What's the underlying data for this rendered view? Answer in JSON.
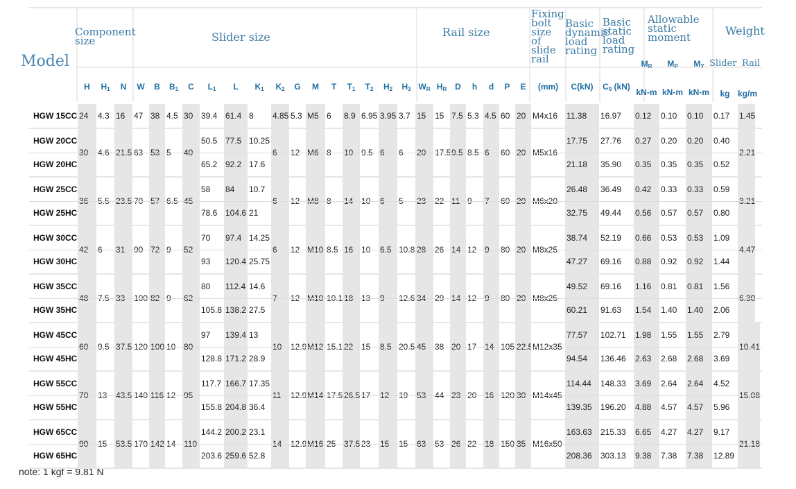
{
  "header": {
    "model": "Model",
    "groups": [
      {
        "id": "component",
        "label": "Component\nsize"
      },
      {
        "id": "slider",
        "label": "Slider size"
      },
      {
        "id": "rail",
        "label": "Rail size"
      },
      {
        "id": "bolt",
        "label": "Fixing\nbolt\nsize\nof\nslide\nrail"
      },
      {
        "id": "dyn",
        "label": "Basic\ndynamic\nload\nrating"
      },
      {
        "id": "stat",
        "label": "Basic\nstatic\nload\nrating"
      },
      {
        "id": "moment",
        "label": "Allowable\nstatic\nmoment"
      },
      {
        "id": "weight",
        "label": "Weight"
      }
    ],
    "columns": [
      {
        "main": "H",
        "sub": ""
      },
      {
        "main": "H",
        "sub": "1"
      },
      {
        "main": "N",
        "sub": ""
      },
      {
        "main": "W",
        "sub": ""
      },
      {
        "main": "B",
        "sub": ""
      },
      {
        "main": "B",
        "sub": "1"
      },
      {
        "main": "C",
        "sub": ""
      },
      {
        "main": "L",
        "sub": "1"
      },
      {
        "main": "L",
        "sub": ""
      },
      {
        "main": "K",
        "sub": "1"
      },
      {
        "main": "K",
        "sub": "2"
      },
      {
        "main": "G",
        "sub": ""
      },
      {
        "main": "M",
        "sub": ""
      },
      {
        "main": "T",
        "sub": ""
      },
      {
        "main": "T",
        "sub": "1"
      },
      {
        "main": "T",
        "sub": "2"
      },
      {
        "main": "H",
        "sub": "2"
      },
      {
        "main": "H",
        "sub": "3"
      },
      {
        "main": "W",
        "sub": "R"
      },
      {
        "main": "H",
        "sub": "R"
      },
      {
        "main": "D",
        "sub": ""
      },
      {
        "main": "h",
        "sub": ""
      },
      {
        "main": "d",
        "sub": ""
      },
      {
        "main": "P",
        "sub": ""
      },
      {
        "main": "E",
        "sub": ""
      },
      {
        "main": "(mm)",
        "sub": ""
      },
      {
        "main": "C(kN)",
        "sub": ""
      },
      {
        "main": "C",
        "sub": "0",
        "tail": " (kN)"
      }
    ],
    "moments": [
      {
        "main": "M",
        "sub": "R",
        "unit": "kN-m"
      },
      {
        "main": "M",
        "sub": "P",
        "unit": "kN-m"
      },
      {
        "main": "M",
        "sub": "Y",
        "unit": "kN-m"
      }
    ],
    "weight_cols": [
      {
        "label": "Slider",
        "unit": "kg"
      },
      {
        "label": "Rail",
        "unit": "kg/m"
      }
    ]
  },
  "rows": [
    {
      "model": "HGW 15CC",
      "cells": [
        "24",
        "4.3",
        "16",
        "47",
        "38",
        "4.5",
        "30",
        "39.4",
        "61.4",
        "8",
        "4.85",
        "5.3",
        "M5",
        "6",
        "8.9",
        "6.95",
        "3.95",
        "3.7",
        "15",
        "15",
        "7.5",
        "5.3",
        "4.5",
        "60",
        "20",
        "M4x16",
        "11.38",
        "16.97",
        "0.12",
        "0.10",
        "0.10",
        "0.17",
        "1.45"
      ]
    },
    {
      "group": [
        {
          "model": "HGW 20CC",
          "L1": "50.5",
          "L": "77.5",
          "K1": "10.25",
          "C": "17.75",
          "C0": "27.76",
          "MR": "0.27",
          "MP": "0.20",
          "MY": "0.20",
          "kg": "0.40"
        },
        {
          "model": "HGW 20HC",
          "L1": "65.2",
          "L": "92.2",
          "K1": "17.6",
          "C": "21.18",
          "C0": "35.90",
          "MR": "0.35",
          "MP": "0.35",
          "MY": "0.35",
          "kg": "0.52"
        }
      ],
      "shared": {
        "H": "30",
        "H1": "4.6",
        "N": "21.5",
        "W": "63",
        "B": "53",
        "B1": "5",
        "Cc": "40",
        "K2": "6",
        "G": "12",
        "M": "M6",
        "T": "8",
        "T1": "10",
        "T2": "9.5",
        "H2": "6",
        "H3": "6",
        "WR": "20",
        "HR": "17.5",
        "D": "9.5",
        "h": "8.5",
        "d": "6",
        "P": "60",
        "E": "20",
        "bolt": "M5x16",
        "rail": "2.21"
      }
    },
    {
      "group": [
        {
          "model": "HGW 25CC",
          "L1": "58",
          "L": "84",
          "K1": "10.7",
          "C": "26.48",
          "C0": "36.49",
          "MR": "0.42",
          "MP": "0.33",
          "MY": "0.33",
          "kg": "0.59"
        },
        {
          "model": "HGW 25HC",
          "L1": "78.6",
          "L": "104.6",
          "K1": "21",
          "C": "32.75",
          "C0": "49.44",
          "MR": "0.56",
          "MP": "0.57",
          "MY": "0.57",
          "kg": "0.80"
        }
      ],
      "shared": {
        "H": "36",
        "H1": "5.5",
        "N": "23.5",
        "W": "70",
        "B": "57",
        "B1": "6.5",
        "Cc": "45",
        "K2": "6",
        "G": "12",
        "M": "M8",
        "T": "8",
        "T1": "14",
        "T2": "10",
        "H2": "6",
        "H3": "5",
        "WR": "23",
        "HR": "22",
        "D": "11",
        "h": "9",
        "d": "7",
        "P": "60",
        "E": "20",
        "bolt": "M6x20",
        "rail": "3.21"
      }
    },
    {
      "group": [
        {
          "model": "HGW 30CC",
          "L1": "70",
          "L": "97.4",
          "K1": "14.25",
          "C": "38.74",
          "C0": "52.19",
          "MR": "0.66",
          "MP": "0.53",
          "MY": "0.53",
          "kg": "1.09"
        },
        {
          "model": "HGW 30HC",
          "L1": "93",
          "L": "120.4",
          "K1": "25.75",
          "C": "47.27",
          "C0": "69.16",
          "MR": "0.88",
          "MP": "0.92",
          "MY": "0.92",
          "kg": "1.44"
        }
      ],
      "shared": {
        "H": "42",
        "H1": "6",
        "N": "31",
        "W": "90",
        "B": "72",
        "B1": "9",
        "Cc": "52",
        "K2": "6",
        "G": "12",
        "M": "M10",
        "T": "8.5",
        "T1": "16",
        "T2": "10",
        "H2": "6.5",
        "H3": "10.8",
        "WR": "28",
        "HR": "26",
        "D": "14",
        "h": "12",
        "d": "9",
        "P": "80",
        "E": "20",
        "bolt": "M8x25",
        "rail": "4.47"
      }
    },
    {
      "group": [
        {
          "model": "HGW 35CC",
          "L1": "80",
          "L": "112.4",
          "K1": "14.6",
          "C": "49.52",
          "C0": "69.16",
          "MR": "1.16",
          "MP": "0.81",
          "MY": "0.81",
          "kg": "1.56"
        },
        {
          "model": "HGW 35HC",
          "L1": "105.8",
          "L": "138.2",
          "K1": "27.5",
          "C": "60.21",
          "C0": "91.63",
          "MR": "1.54",
          "MP": "1.40",
          "MY": "1.40",
          "kg": "2.06"
        }
      ],
      "shared": {
        "H": "48",
        "H1": "7.5",
        "N": "33",
        "W": "100",
        "B": "82",
        "B1": "9",
        "Cc": "62",
        "K2": "7",
        "G": "12",
        "M": "M10",
        "T": "10.1",
        "T1": "18",
        "T2": "13",
        "H2": "9",
        "H3": "12.6",
        "WR": "34",
        "HR": "29",
        "D": "14",
        "h": "12",
        "d": "9",
        "P": "80",
        "E": "20",
        "bolt": "M8x25",
        "rail": "6.30"
      }
    },
    {
      "group": [
        {
          "model": "HGW 45CC",
          "L1": "97",
          "L": "139.4",
          "K1": "13",
          "C": "77.57",
          "C0": "102.71",
          "MR": "1.98",
          "MP": "1.55",
          "MY": "1.55",
          "kg": "2.79"
        },
        {
          "model": "HGW 45HC",
          "L1": "128.8",
          "L": "171.2",
          "K1": "28.9",
          "C": "94.54",
          "C0": "136.46",
          "MR": "2.63",
          "MP": "2.68",
          "MY": "2.68",
          "kg": "3.69"
        }
      ],
      "shared": {
        "H": "60",
        "H1": "9.5",
        "N": "37.5",
        "W": "120",
        "B": "100",
        "B1": "10",
        "Cc": "80",
        "K2": "10",
        "G": "12.9",
        "M": "M12",
        "T": "15.1",
        "T1": "22",
        "T2": "15",
        "H2": "8.5",
        "H3": "20.5",
        "WR": "45",
        "HR": "38",
        "D": "20",
        "h": "17",
        "d": "14",
        "P": "105",
        "E": "22.5",
        "bolt": "M12x35",
        "rail": "10.41"
      }
    },
    {
      "group": [
        {
          "model": "HGW 55CC",
          "L1": "117.7",
          "L": "166.7",
          "K1": "17.35",
          "C": "114.44",
          "C0": "148.33",
          "MR": "3.69",
          "MP": "2.64",
          "MY": "2.64",
          "kg": "4.52"
        },
        {
          "model": "HGW 55HC",
          "L1": "155.8",
          "L": "204.8",
          "K1": "36.4",
          "C": "139.35",
          "C0": "196.20",
          "MR": "4.88",
          "MP": "4.57",
          "MY": "4.57",
          "kg": "5.96"
        }
      ],
      "shared": {
        "H": "70",
        "H1": "13",
        "N": "43.5",
        "W": "140",
        "B": "116",
        "B1": "12",
        "Cc": "95",
        "K2": "11",
        "G": "12.9",
        "M": "M14",
        "T": "17.5",
        "T1": "26.5",
        "T2": "17",
        "H2": "12",
        "H3": "19",
        "WR": "53",
        "HR": "44",
        "D": "23",
        "h": "20",
        "d": "16",
        "P": "120",
        "E": "30",
        "bolt": "M14x45",
        "rail": "15.08"
      }
    },
    {
      "group": [
        {
          "model": "HGW 65CC",
          "L1": "144.2",
          "L": "200.2",
          "K1": "23.1",
          "C": "163.63",
          "C0": "215.33",
          "MR": "6.65",
          "MP": "4.27",
          "MY": "4.27",
          "kg": "9.17"
        },
        {
          "model": "HGW 65HC",
          "L1": "203.6",
          "L": "259.6",
          "K1": "52.8",
          "C": "208.36",
          "C0": "303.13",
          "MR": "9.38",
          "MP": "7.38",
          "MY": "7.38",
          "kg": "12.89"
        }
      ],
      "shared": {
        "H": "90",
        "H1": "15",
        "N": "53.5",
        "W": "170",
        "B": "142",
        "B1": "14",
        "Cc": "110",
        "K2": "14",
        "G": "12.9",
        "M": "M16",
        "T": "25",
        "T1": "37.5",
        "T2": "23",
        "H2": "15",
        "H3": "15",
        "WR": "63",
        "HR": "53",
        "D": "26",
        "h": "22",
        "d": "18",
        "P": "150",
        "E": "35",
        "bolt": "M16x50",
        "rail": "21.18"
      }
    }
  ],
  "note": "note: 1 kgf = 9.81 N",
  "colors": {
    "header_text": "#3b7ba5",
    "grey": "#e6e6e6",
    "rule": "#e6e6e6"
  }
}
